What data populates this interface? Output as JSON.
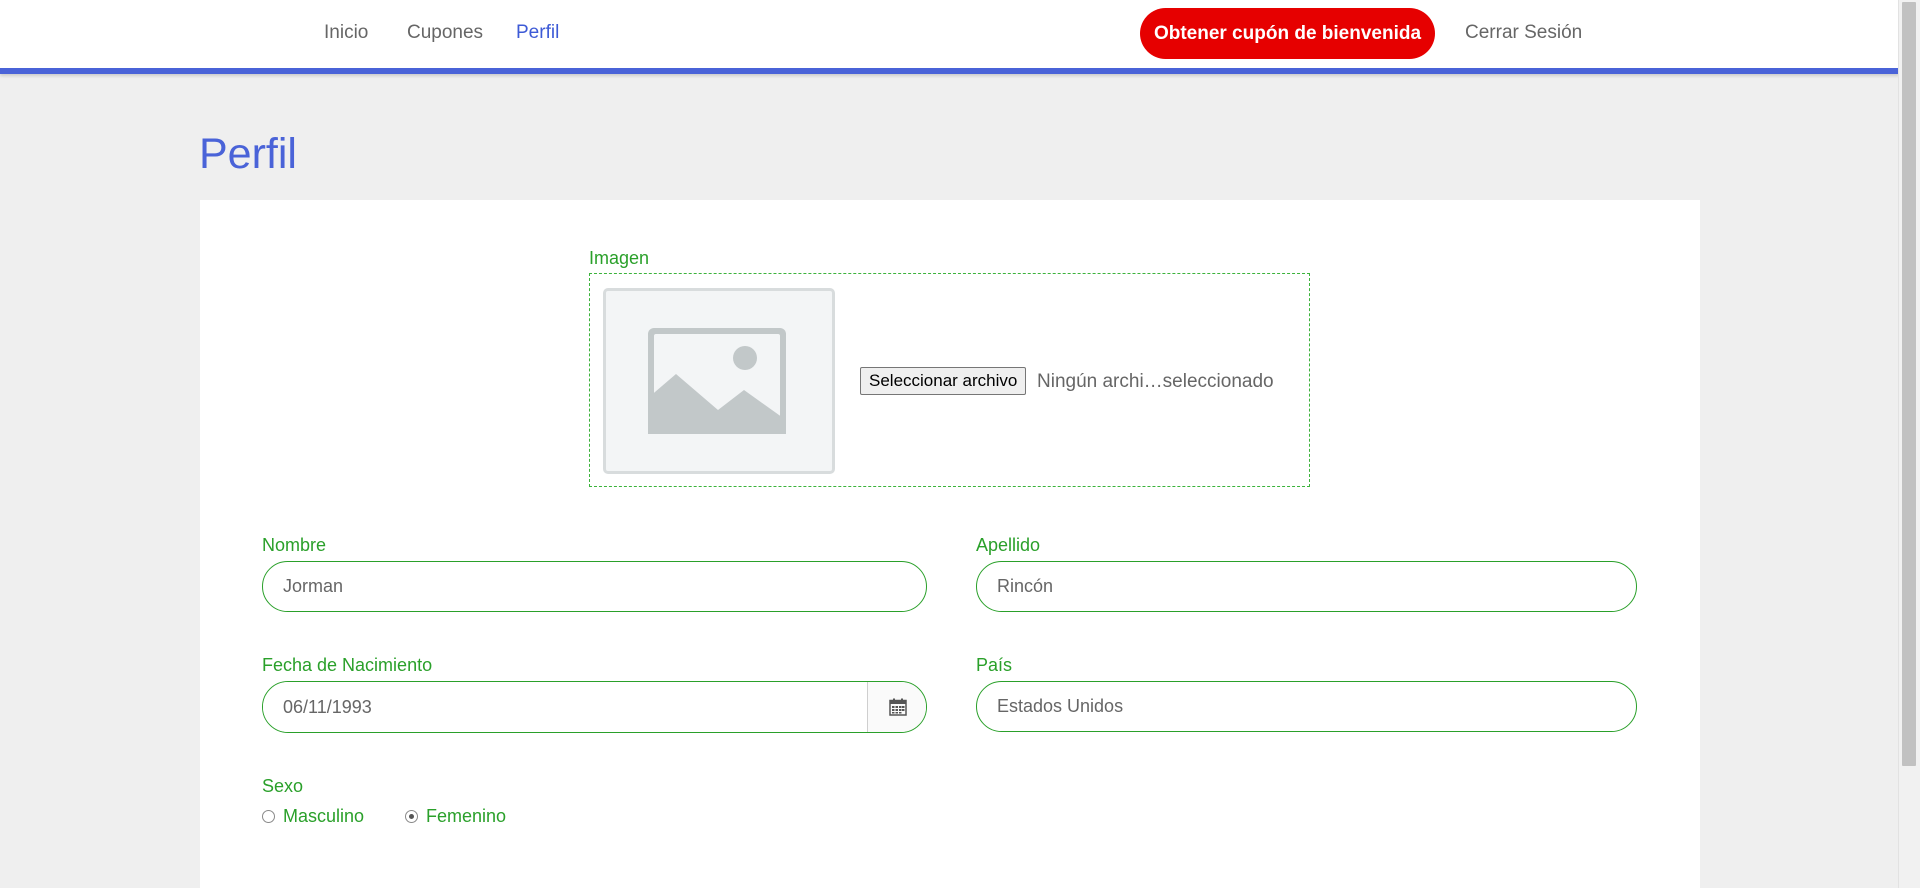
{
  "nav": {
    "items": [
      {
        "label": "Inicio",
        "active": false
      },
      {
        "label": "Cupones",
        "active": false
      },
      {
        "label": "Perfil",
        "active": true
      }
    ],
    "cta_label": "Obtener cupón de bienvenida",
    "logout_label": "Cerrar Sesión",
    "colors": {
      "accent": "#4a63d8",
      "cta": "#e60000",
      "field": "#2aa02a"
    }
  },
  "profile": {
    "title": "Perfil",
    "image": {
      "label": "Imagen",
      "button_label": "Seleccionar archivo",
      "status": "Ningún archi…seleccionado",
      "placeholder_icon": "image-placeholder-icon"
    },
    "first_name": {
      "label": "Nombre",
      "value": "Jorman"
    },
    "last_name": {
      "label": "Apellido",
      "value": "Rincón"
    },
    "birth_date": {
      "label": "Fecha de Nacimiento",
      "value": "06/11/1993",
      "icon": "calendar-icon"
    },
    "country": {
      "label": "País",
      "value": "Estados Unidos"
    },
    "gender": {
      "label": "Sexo",
      "options": [
        {
          "label": "Masculino",
          "checked": false
        },
        {
          "label": "Femenino",
          "checked": true
        }
      ]
    }
  }
}
